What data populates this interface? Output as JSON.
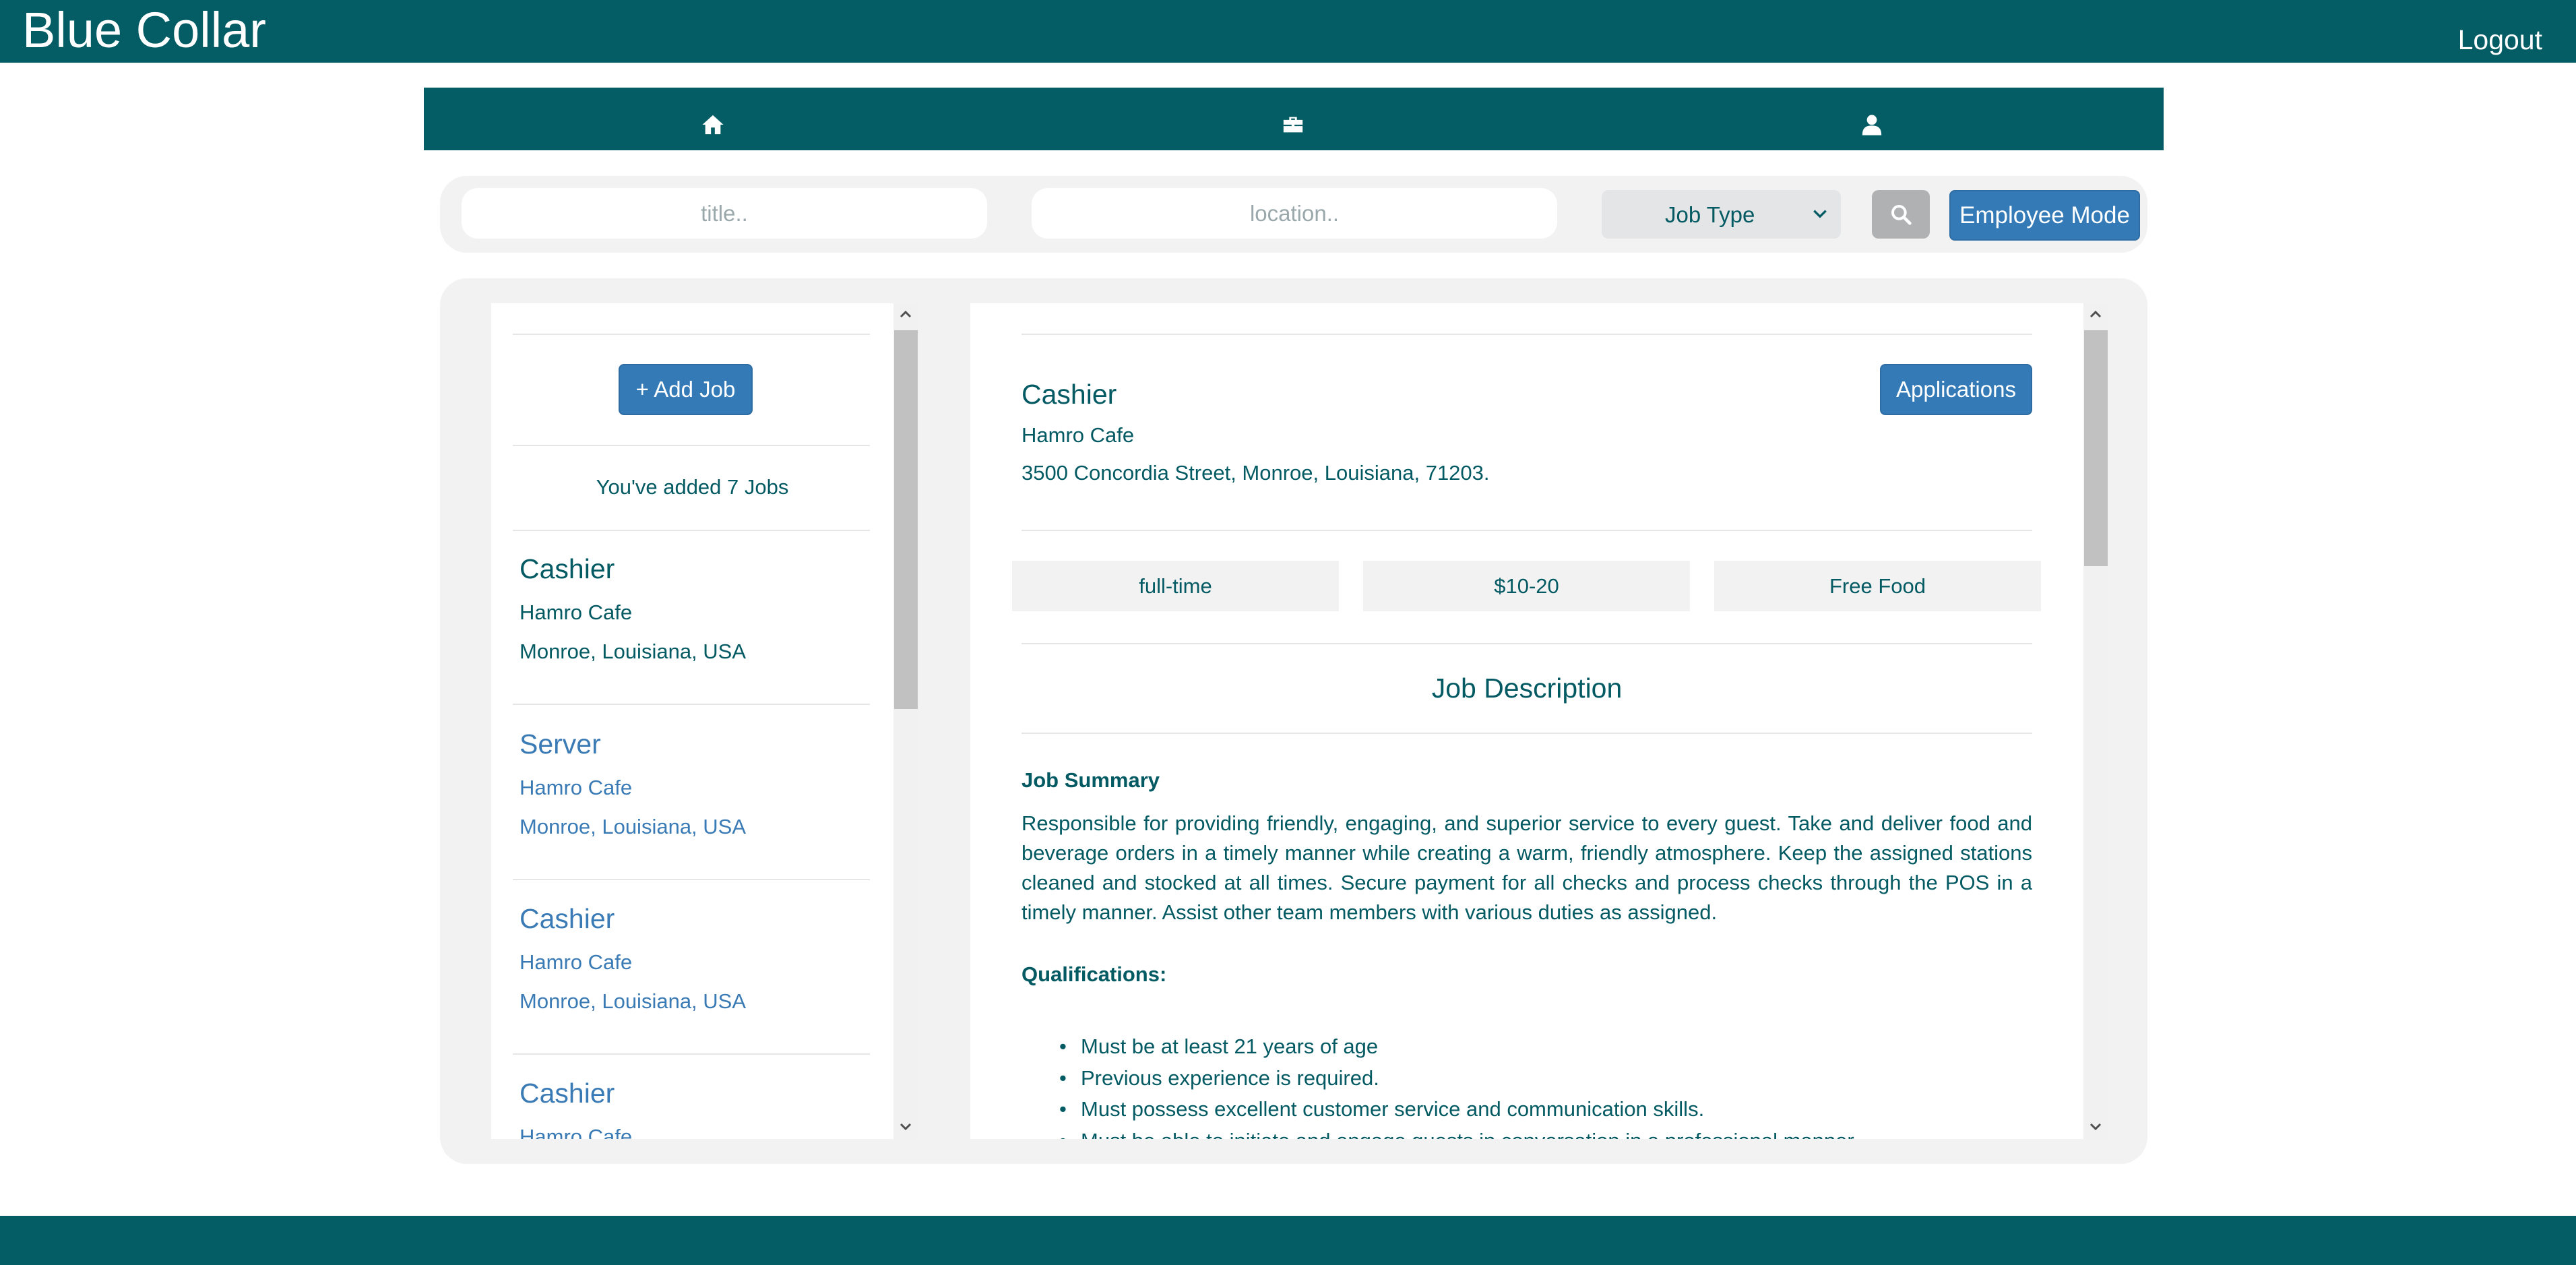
{
  "app": {
    "brand": "Blue Collar",
    "logout": "Logout"
  },
  "nav": {
    "items": [
      {
        "icon": "home-icon"
      },
      {
        "icon": "briefcase-icon"
      },
      {
        "icon": "user-icon"
      }
    ]
  },
  "search": {
    "title_placeholder": "title..",
    "location_placeholder": "location..",
    "job_type_selected": "Job Type",
    "search_icon": "search-icon",
    "mode_button": "Employee Mode"
  },
  "jobs_panel": {
    "add_button": "+ Add Job",
    "count_text": "You've added 7 Jobs",
    "items": [
      {
        "title": "Cashier",
        "company": "Hamro Cafe",
        "location": "Monroe, Louisiana, USA",
        "selected": true
      },
      {
        "title": "Server",
        "company": "Hamro Cafe",
        "location": "Monroe, Louisiana, USA",
        "selected": false
      },
      {
        "title": "Cashier",
        "company": "Hamro Cafe",
        "location": "Monroe, Louisiana, USA",
        "selected": false
      },
      {
        "title": "Cashier",
        "company": "Hamro Cafe",
        "location": "",
        "selected": false
      }
    ]
  },
  "job_detail": {
    "title": "Cashier",
    "company": "Hamro Cafe",
    "address": "3500 Concordia Street, Monroe, Louisiana, 71203.",
    "applications_button": "Applications",
    "tags": [
      "full-time",
      "$10-20",
      "Free Food"
    ],
    "description_heading": "Job Description",
    "summary_heading": "Job Summary",
    "summary_text": "Responsible for providing friendly, engaging, and superior service to every guest. Take and deliver food and beverage orders in a timely manner while creating a warm, friendly atmosphere. Keep the assigned stations cleaned and stocked at all times. Secure payment for all checks and process checks through the POS in a timely manner. Assist other team members with various duties as assigned.",
    "qualifications_heading": "Qualifications:",
    "qualifications": [
      "Must be at least 21 years of age",
      "Previous experience is required.",
      "Must possess excellent customer service and communication skills.",
      "Must be able to initiate and engage guests in conversation in a professional manner."
    ]
  },
  "colors": {
    "primary": "#045c64",
    "accent": "#337ab7",
    "text": "#035a63",
    "link": "#3a7bb5"
  }
}
